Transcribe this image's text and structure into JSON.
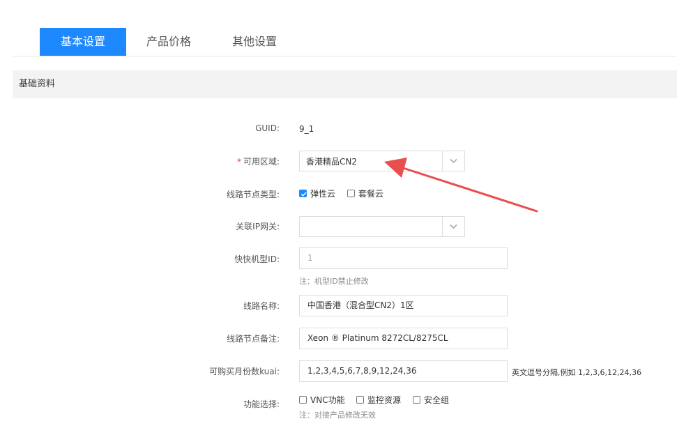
{
  "tabs": [
    {
      "label": "基本设置",
      "active": true
    },
    {
      "label": "产品价格",
      "active": false
    },
    {
      "label": "其他设置",
      "active": false
    }
  ],
  "section_title": "基础资料",
  "form": {
    "guid": {
      "label": "GUID:",
      "value": "9_1"
    },
    "region": {
      "required_mark": "*",
      "label": "可用区域:",
      "value": "香港精品CN2"
    },
    "node_type": {
      "label": "线路节点类型:",
      "options": [
        {
          "label": "弹性云",
          "checked": true
        },
        {
          "label": "套餐云",
          "checked": false
        }
      ]
    },
    "gateway": {
      "label": "关联IP网关:",
      "value": ""
    },
    "model_id": {
      "label": "快快机型ID:",
      "value": "1",
      "hint": "注：机型ID禁止修改"
    },
    "line_name": {
      "label": "线路名称:",
      "value": "中国香港（混合型CN2）1区"
    },
    "node_remark": {
      "label": "线路节点备注:",
      "value": "Xeon ® Platinum 8272CL/8275CL"
    },
    "months": {
      "label": "可购买月份数kuai:",
      "value": "1,2,3,4,5,6,7,8,9,12,24,36",
      "hint": "英文逗号分隔,例如 1,2,3,6,12,24,36"
    },
    "features": {
      "label": "功能选择:",
      "options": [
        {
          "label": "VNC功能",
          "checked": false
        },
        {
          "label": "监控资源",
          "checked": false
        },
        {
          "label": "安全组",
          "checked": false
        }
      ],
      "hint": "注：对接产品修改无效"
    }
  },
  "colors": {
    "accent": "#1e88ff",
    "annotation_arrow": "#e8504f"
  },
  "icons": {
    "select_arrow": "chevron-down-icon",
    "checkbox_check": "check-icon"
  }
}
